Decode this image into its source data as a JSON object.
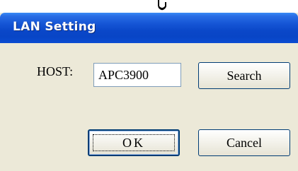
{
  "window": {
    "title": "LAN Setting"
  },
  "form": {
    "host_label": "HOST:",
    "host_value": "APC3900"
  },
  "buttons": {
    "search_label": "Search",
    "ok_label": "OK",
    "cancel_label": "Cancel"
  },
  "icons": {
    "cursor": "mouse-cursor-icon"
  },
  "colors": {
    "titlebar": "#0a47c8",
    "dialog_background": "#ece9d8",
    "button_border": "#003c74"
  }
}
